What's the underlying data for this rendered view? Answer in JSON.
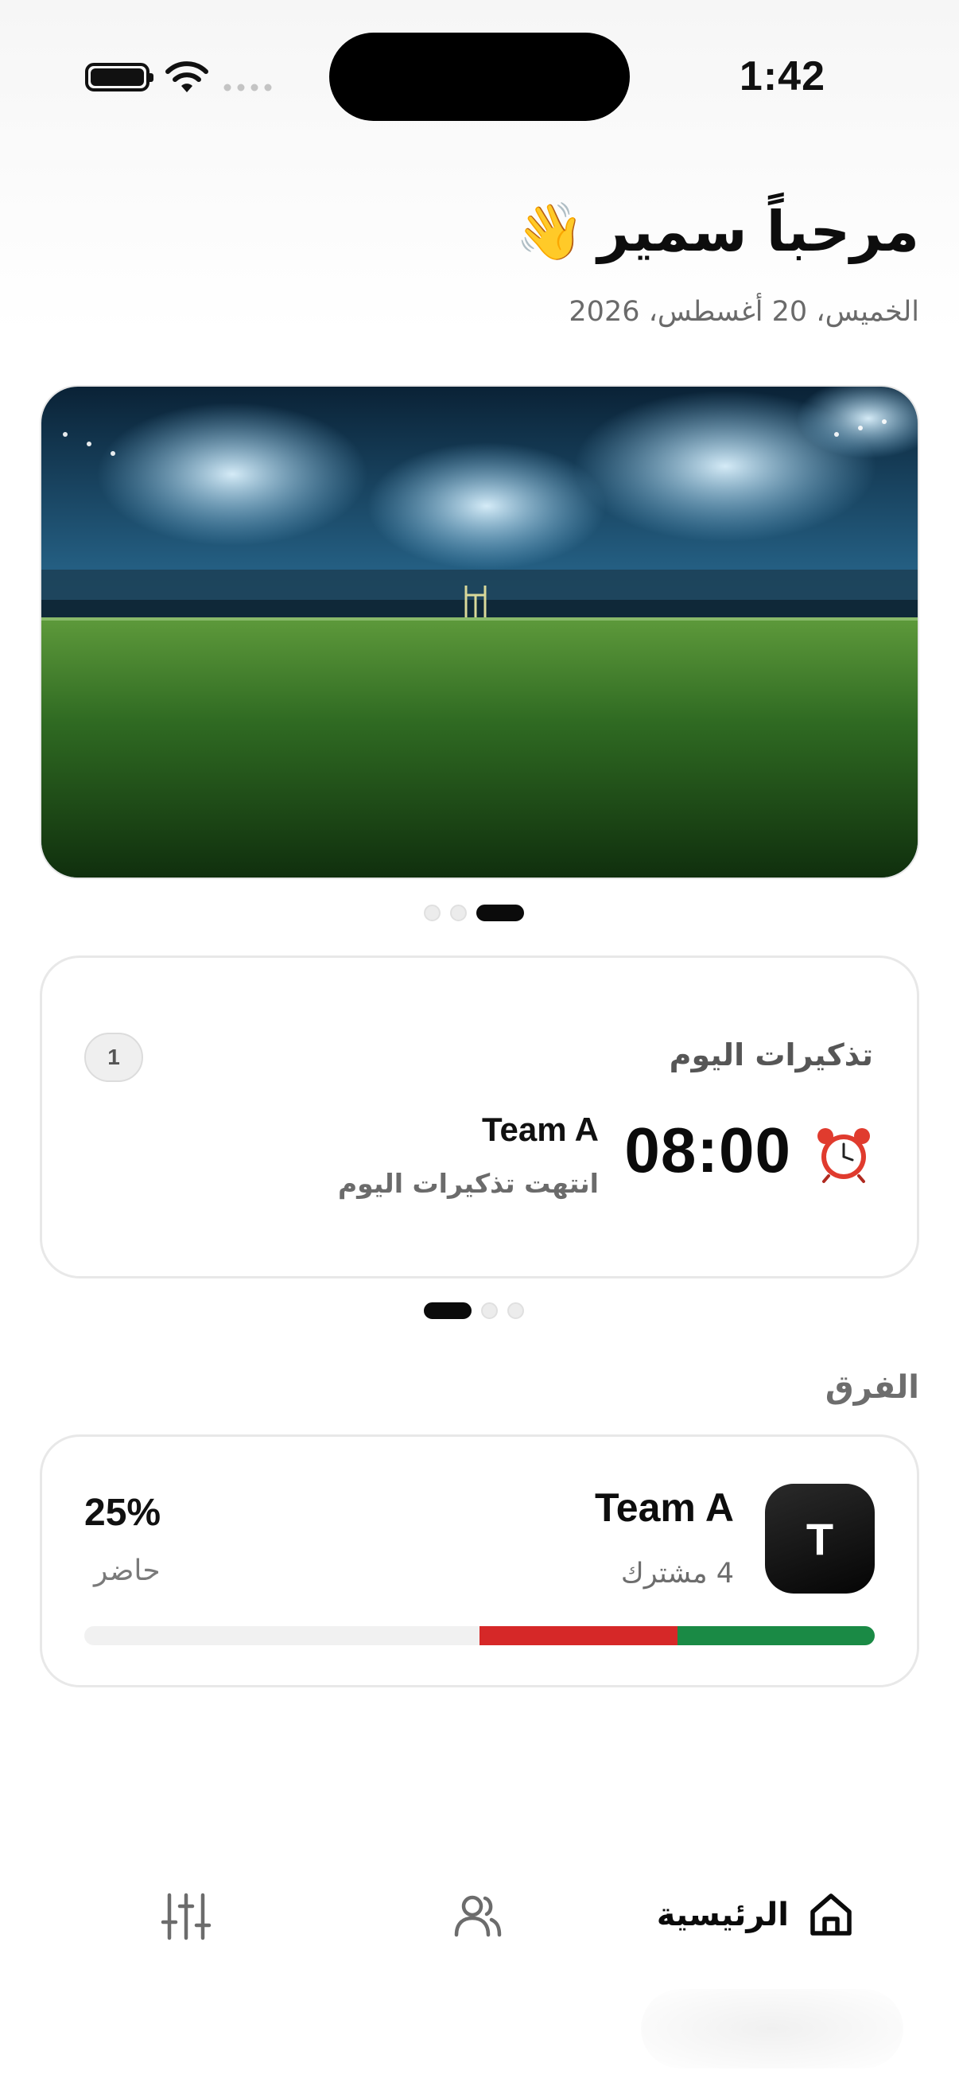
{
  "status_bar": {
    "time": "1:42"
  },
  "header": {
    "greeting": "مرحباً سمير",
    "wave_emoji": "👋",
    "date": "الخميس، 20 أغسطس، 2026"
  },
  "hero": {
    "image_icon": "stadium-image",
    "pagination": {
      "count": 3,
      "active_index": 2
    }
  },
  "reminders": {
    "title": "تذكيرات اليوم",
    "count": "1",
    "items": [
      {
        "time": "08:00",
        "team": "Team A",
        "subtitle": "انتهت تذكيرات اليوم",
        "icon": "alarm-clock-icon"
      }
    ],
    "pagination": {
      "count": 3,
      "active_index": 0
    }
  },
  "teams": {
    "section_title": "الفرق",
    "items": [
      {
        "avatar_letter": "T",
        "name": "Team A",
        "members": "4 مشترك",
        "percent": "25%",
        "percent_label": "حاضر",
        "progress": {
          "present": 0.25,
          "absent": 0.25,
          "colors": {
            "present": "#1a8a45",
            "absent": "#d62828",
            "track": "#f1f1f1"
          }
        }
      }
    ]
  },
  "bottom_nav": {
    "items": [
      {
        "label": "الرئيسية",
        "icon": "home-icon",
        "active": true
      },
      {
        "label": "",
        "icon": "users-icon",
        "active": false
      },
      {
        "label": "",
        "icon": "sliders-icon",
        "active": false
      }
    ]
  }
}
